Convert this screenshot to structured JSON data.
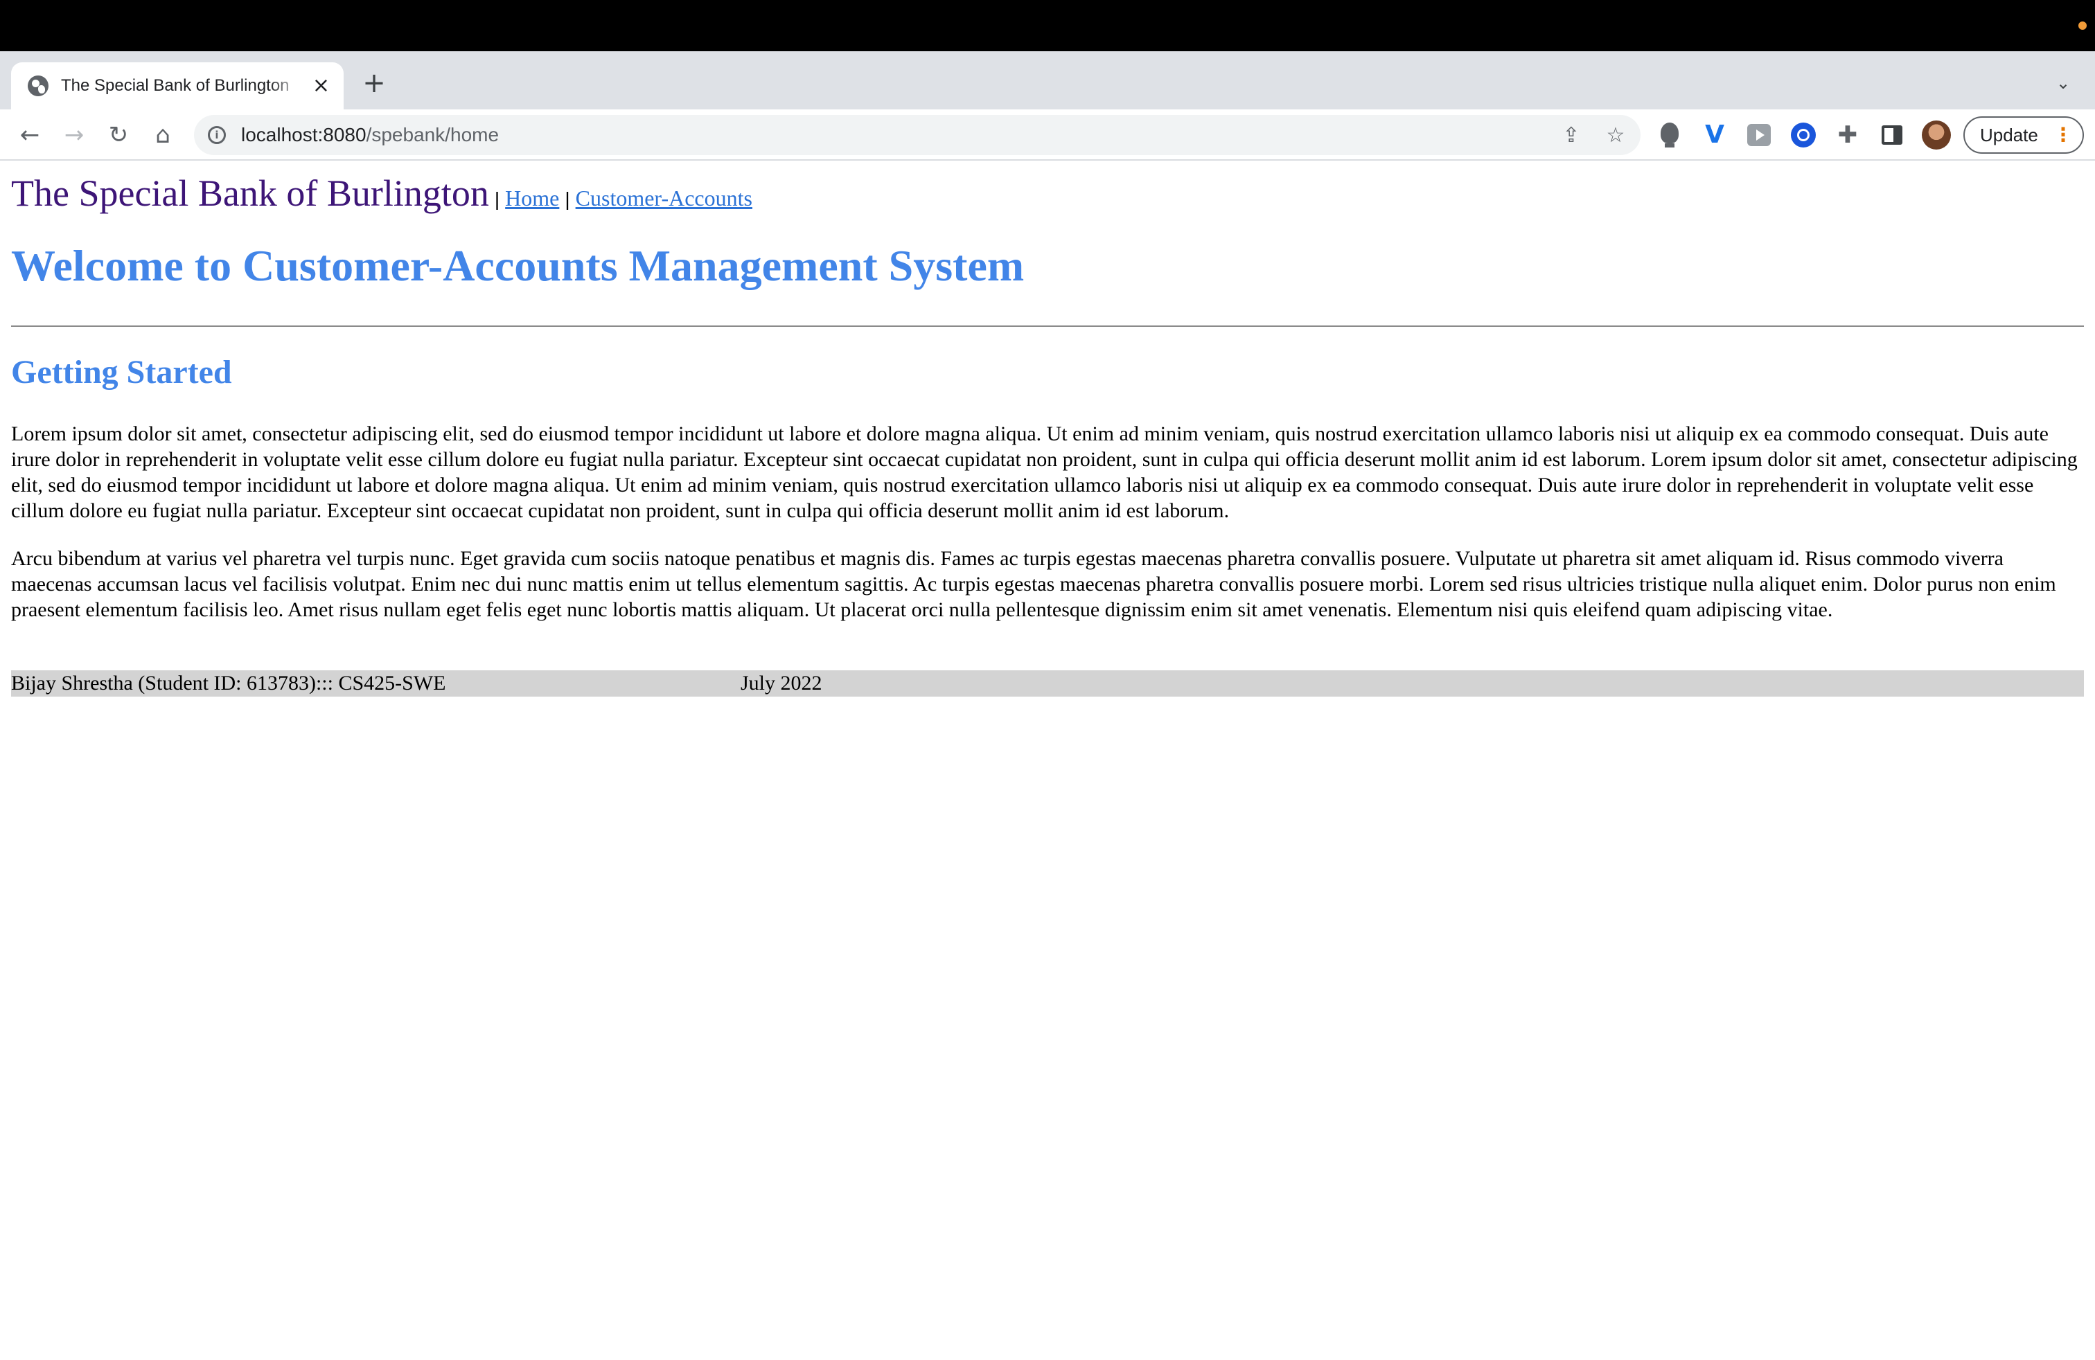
{
  "browser": {
    "tab": {
      "title": "The Special Bank of Burlington",
      "close_icon": "×"
    },
    "new_tab_icon": "+",
    "tab_list_icon": "⌄",
    "toolbar": {
      "back_icon": "←",
      "forward_icon": "→",
      "reload_icon": "↻",
      "home_icon": "⌂",
      "info_icon": "i",
      "url_host": "localhost:8080",
      "url_path": "/spebank/home",
      "share_icon": "⇪",
      "bookmark_icon": "☆",
      "extension_icons": [
        "lightbulb-icon",
        "v-extension-icon",
        "play-extension-icon",
        "ring-extension-icon",
        "puzzle-icon",
        "side-panel-icon"
      ],
      "puzzle_glyph": "✚",
      "v_glyph": "V",
      "update_label": "Update",
      "menu_glyph": "⋮"
    }
  },
  "page": {
    "brand": "The Special Bank of Burlington",
    "separator": "|",
    "nav": {
      "home": "Home",
      "customer_accounts": "Customer-Accounts"
    },
    "welcome_heading": "Welcome to Customer-Accounts Management System",
    "section_heading": "Getting Started",
    "paragraphs": [
      "Lorem ipsum dolor sit amet, consectetur adipiscing elit, sed do eiusmod tempor incididunt ut labore et dolore magna aliqua. Ut enim ad minim veniam, quis nostrud exercitation ullamco laboris nisi ut aliquip ex ea commodo consequat. Duis aute irure dolor in reprehenderit in voluptate velit esse cillum dolore eu fugiat nulla pariatur. Excepteur sint occaecat cupidatat non proident, sunt in culpa qui officia deserunt mollit anim id est laborum. Lorem ipsum dolor sit amet, consectetur adipiscing elit, sed do eiusmod tempor incididunt ut labore et dolore magna aliqua. Ut enim ad minim veniam, quis nostrud exercitation ullamco laboris nisi ut aliquip ex ea commodo consequat. Duis aute irure dolor in reprehenderit in voluptate velit esse cillum dolore eu fugiat nulla pariatur. Excepteur sint occaecat cupidatat non proident, sunt in culpa qui officia deserunt mollit anim id est laborum.",
      "Arcu bibendum at varius vel pharetra vel turpis nunc. Eget gravida cum sociis natoque penatibus et magnis dis. Fames ac turpis egestas maecenas pharetra convallis posuere. Vulputate ut pharetra sit amet aliquam id. Risus commodo viverra maecenas accumsan lacus vel facilisis volutpat. Enim nec dui nunc mattis enim ut tellus elementum sagittis. Ac turpis egestas maecenas pharetra convallis posuere morbi. Lorem sed risus ultricies tristique nulla aliquet enim. Dolor purus non enim praesent elementum facilisis leo. Amet risus nullam eget felis eget nunc lobortis mattis aliquam. Ut placerat orci nulla pellentesque dignissim enim sit amet venenatis. Elementum nisi quis eleifend quam adipiscing vitae."
    ],
    "footer": {
      "author": "Bijay Shrestha (Student ID: 613783)::: CS425-SWE",
      "date": "July 2022"
    }
  },
  "colors": {
    "brand": "#3d1577",
    "heading": "#4285e8",
    "link": "#2b72d6",
    "footer_bg": "#d3d3d3"
  }
}
